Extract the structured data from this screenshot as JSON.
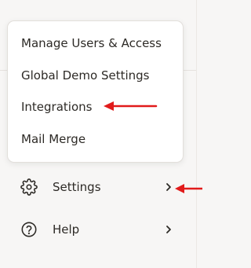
{
  "dropdown": {
    "items": [
      {
        "label": "Manage Users & Access"
      },
      {
        "label": "Global Demo Settings"
      },
      {
        "label": "Integrations"
      },
      {
        "label": "Mail Merge"
      }
    ]
  },
  "nav": {
    "settings": {
      "label": "Settings",
      "icon": "gear-icon"
    },
    "help": {
      "label": "Help",
      "icon": "question-circle-icon"
    }
  },
  "colors": {
    "annotation_arrow": "#e11b1b",
    "text": "#2d2a26",
    "background": "#f7f6f5",
    "popover": "#ffffff"
  }
}
